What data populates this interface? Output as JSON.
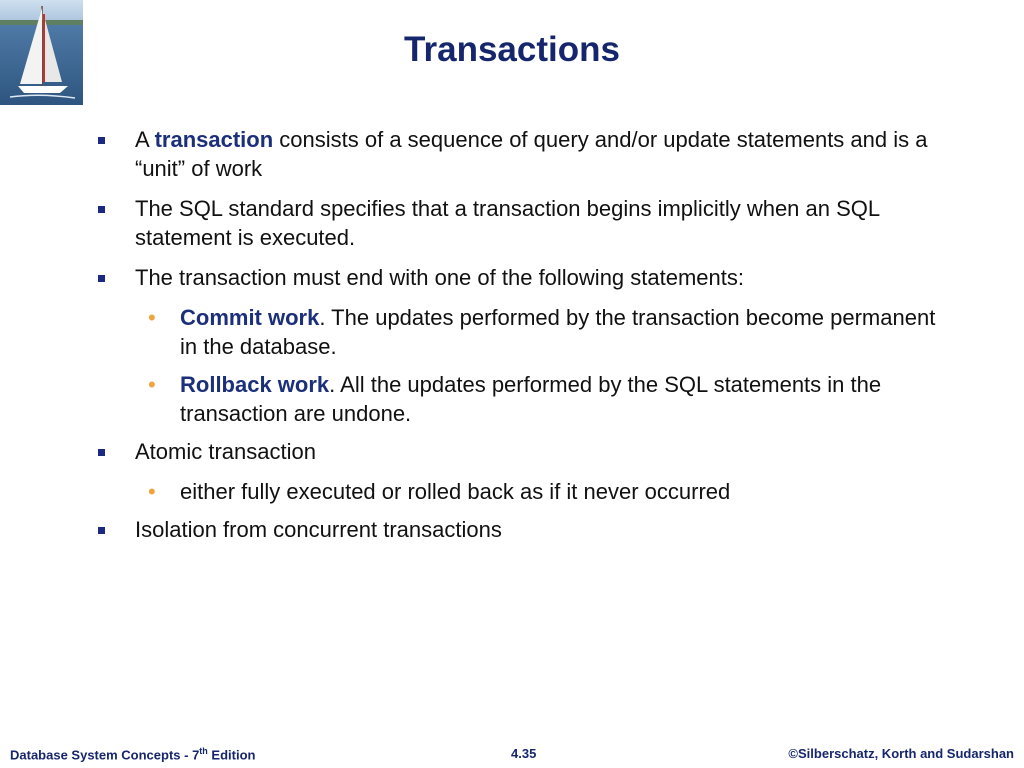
{
  "slide": {
    "title": "Transactions",
    "items": [
      {
        "kw": "transaction",
        "pre": "A  ",
        "post": " consists of a sequence of query and/or update statements and is a “unit” of work"
      },
      {
        "text": "The SQL standard specifies that a transaction begins implicitly when an SQL statement is executed."
      },
      {
        "text": "The transaction must end with one of the following statements:"
      },
      {
        "kw": "Commit work",
        "post": ". The updates performed by the transaction become permanent in the database."
      },
      {
        "kw": "Rollback work",
        "post": ". All  the updates performed by the SQL statements in the transaction are undone."
      },
      {
        "text": "Atomic transaction"
      },
      {
        "text": "either fully executed or rolled back as if it never occurred"
      },
      {
        "text": "Isolation from concurrent transactions"
      }
    ]
  },
  "footer": {
    "left_main": "Database System Concepts - 7",
    "left_sup": "th",
    "left_tail": " Edition",
    "center": "4.35",
    "right": "©Silberschatz, Korth and Sudarshan"
  },
  "colors": {
    "title": "#16266c",
    "keyword": "#1b2f7a",
    "square_bullet": "#1b2a80",
    "sub_bullet": "#f0a440"
  },
  "icons": {
    "logo": "sailboat-logo-icon",
    "bullet_level1": "square-bullet-icon",
    "bullet_level2": "dot-bullet-icon"
  }
}
